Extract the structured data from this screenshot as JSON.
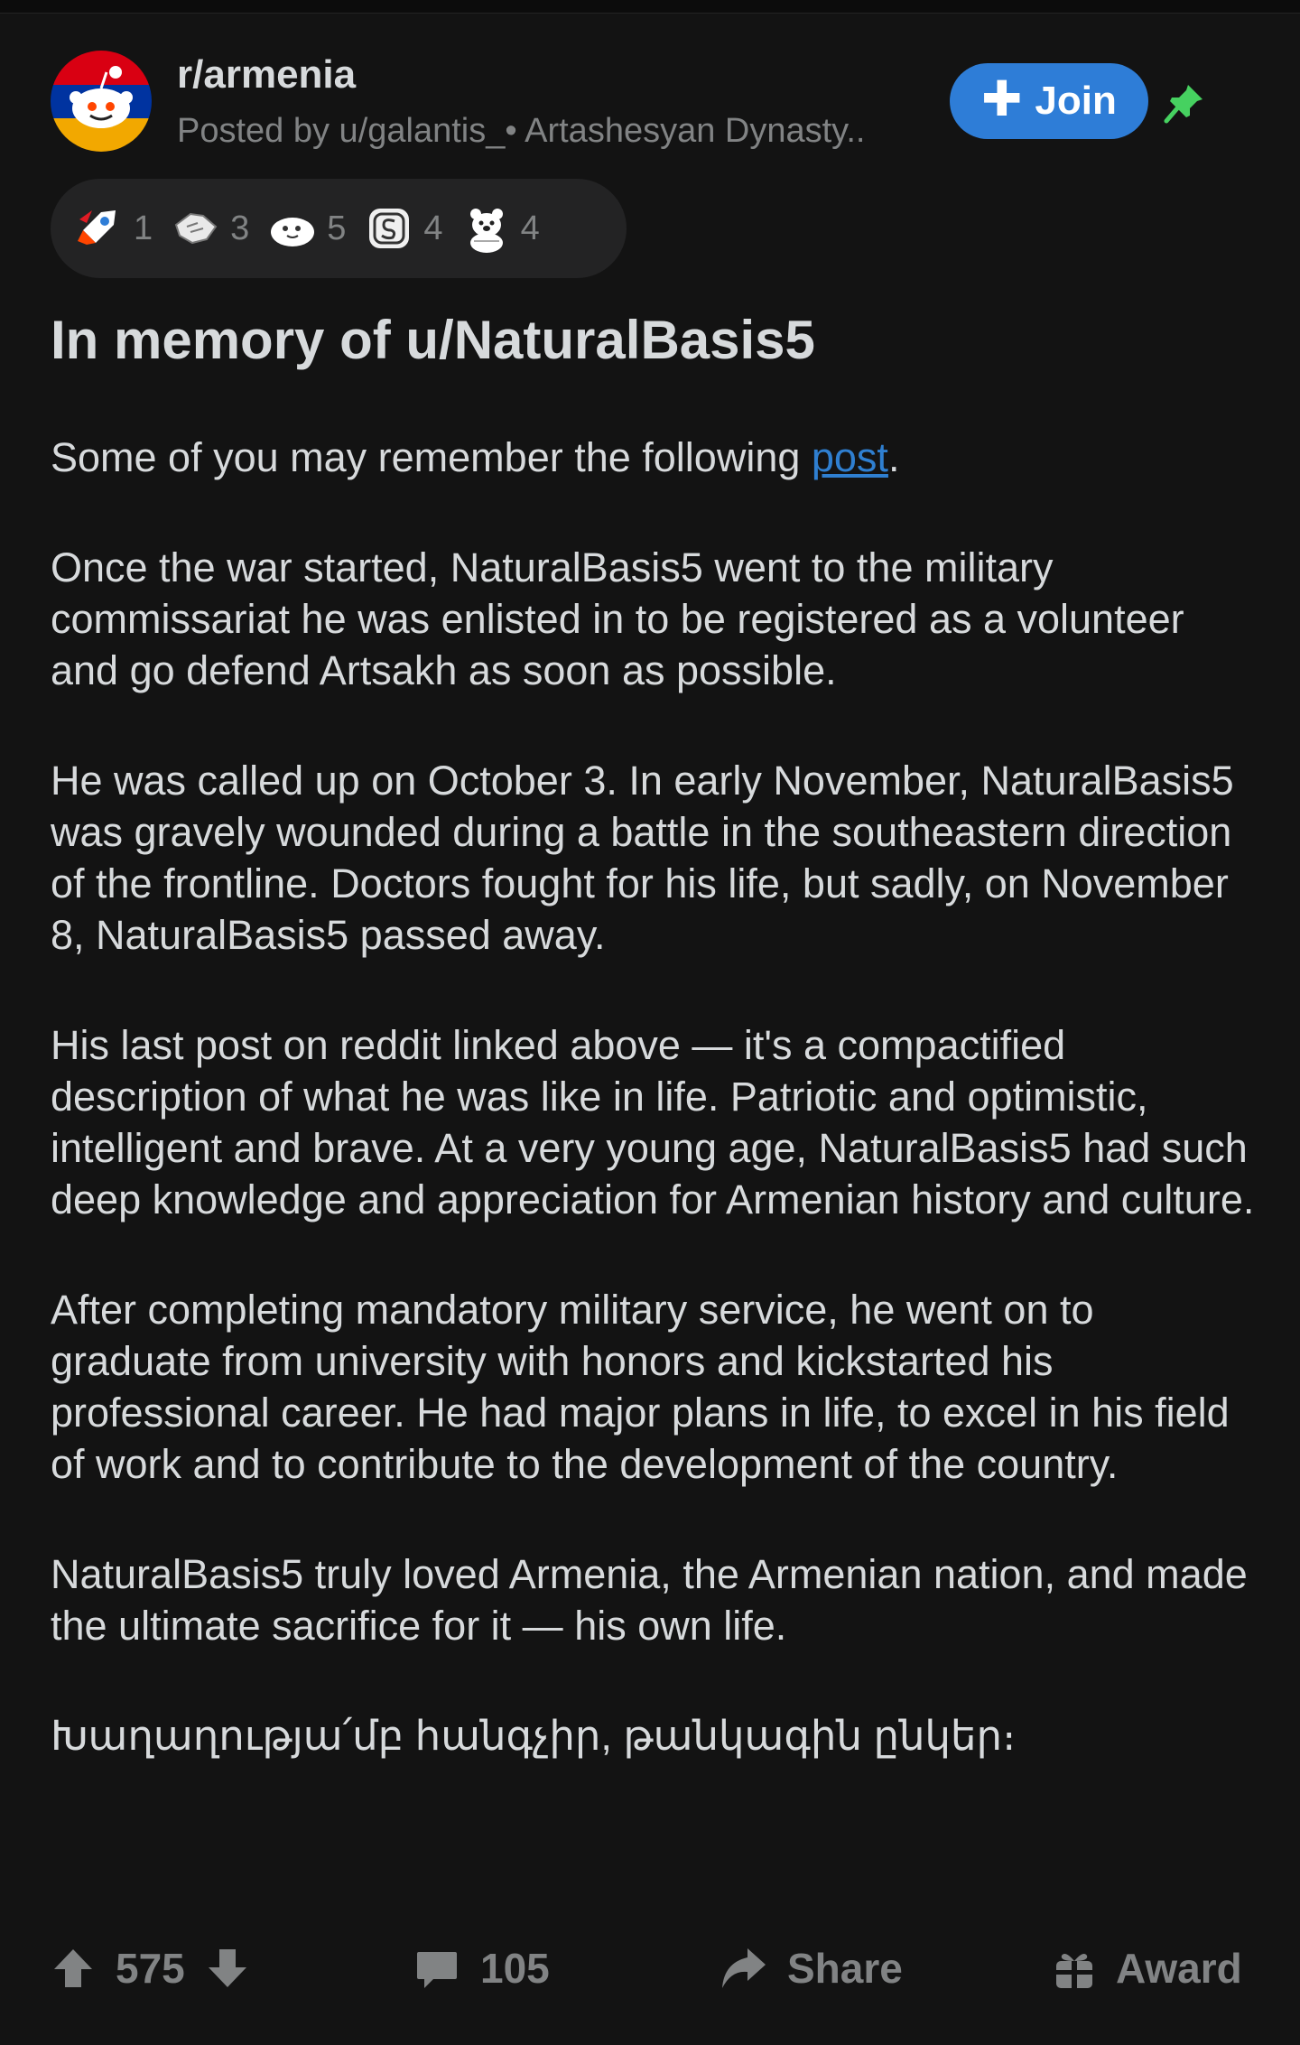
{
  "header": {
    "subreddit": "r/armenia",
    "posted_by": "Posted by u/galantis_• Artashesyan Dynasty..",
    "join_label": "Join"
  },
  "awards": [
    {
      "icon": "rocket-award-icon",
      "count": "1"
    },
    {
      "icon": "handshake-award-icon",
      "count": "3"
    },
    {
      "icon": "blob-award-icon",
      "count": "5"
    },
    {
      "icon": "silver-award-icon",
      "count": "4"
    },
    {
      "icon": "bear-award-icon",
      "count": "4"
    }
  ],
  "post": {
    "title": "In memory of u/NaturalBasis5",
    "p1_prefix": "Some of you may remember the following ",
    "p1_link": "post",
    "p1_suffix": ".",
    "paragraphs": [
      "Once the war started, NaturalBasis5 went to the military commissariat he was enlisted in to be registered as a volunteer and go defend Artsakh as soon as possible.",
      "He was called up on October 3. In early November, NaturalBasis5 was gravely wounded during a battle in the southeastern direction of the frontline. Doctors fought for his life, but sadly, on November 8, NaturalBasis5 passed away.",
      "His last post on reddit linked above — it's a compactified description of what he was like in life. Patriotic and optimistic, intelligent and brave. At a very young age, NaturalBasis5 had such deep knowledge and appreciation for Armenian history and culture.",
      "After completing mandatory military service, he went on to graduate from university with honors and kickstarted his professional career. He had major plans in life, to excel in his field of work and to  contribute to the development of the country.",
      "NaturalBasis5 truly loved Armenia, the Armenian nation, and made the ultimate sacrifice for it — his own life.",
      "Խաղաղությա՛մբ հանգչիր, թանկագին ընկեր։"
    ]
  },
  "actions": {
    "votes": "575",
    "comments": "105",
    "share_label": "Share",
    "award_label": "Award"
  },
  "colors": {
    "background": "#131313",
    "text": "#d7dadc",
    "muted": "#818384",
    "accent_blue": "#2e7dd7",
    "pin_green": "#46d160"
  }
}
